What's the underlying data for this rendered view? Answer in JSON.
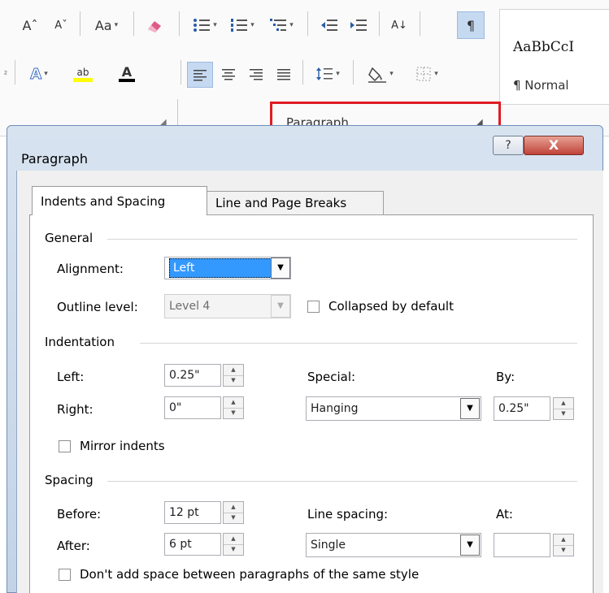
{
  "ribbon": {
    "font_buttons": [
      "Aˆ",
      "Aˇ",
      "Aa",
      "‹"
    ],
    "grow_font": "Aˆ",
    "shrink_font": "Aˇ",
    "change_case": "Aa",
    "superscript_partial": "²",
    "text_effects": "A",
    "highlight": "ab",
    "font_color": "A",
    "sort": "A↓",
    "pilcrow": "¶",
    "group_label": "Paragraph",
    "style_sample": "AaBbCcI",
    "style_name": "¶ Normal",
    "accent_highlight": "#ffff00",
    "accent_font_color": "#c00000"
  },
  "dialog": {
    "title": "Paragraph",
    "help": "?",
    "close": "X",
    "tabs": [
      "Indents and Spacing",
      "Line and Page Breaks"
    ],
    "general": {
      "header": "General",
      "alignment_label": "Alignment:",
      "alignment_value": "Left",
      "outline_label": "Outline level:",
      "outline_value": "Level 4",
      "collapsed_label": "Collapsed by default"
    },
    "indentation": {
      "header": "Indentation",
      "left_label": "Left:",
      "left_value": "0.25\"",
      "right_label": "Right:",
      "right_value": "0\"",
      "special_label": "Special:",
      "special_value": "Hanging",
      "by_label": "By:",
      "by_value": "0.25\"",
      "mirror_label": "Mirror indents"
    },
    "spacing": {
      "header": "Spacing",
      "before_label": "Before:",
      "before_value": "12 pt",
      "after_label": "After:",
      "after_value": "6 pt",
      "line_spacing_label": "Line spacing:",
      "line_spacing_value": "Single",
      "at_label": "At:",
      "at_value": "",
      "dont_add_label": "Don't add space between paragraphs of the same style"
    },
    "selection_color": "#3399ff",
    "highlight_box_color": "#e01c24"
  }
}
